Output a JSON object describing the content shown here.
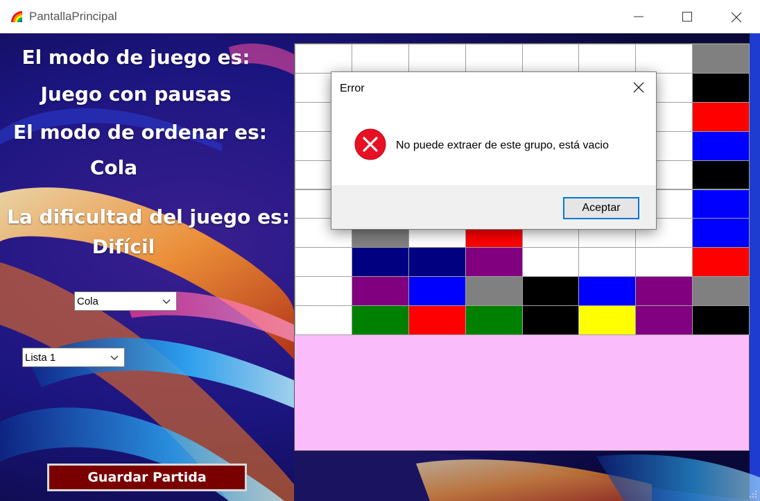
{
  "window": {
    "title": "PantallaPrincipal"
  },
  "labels": {
    "game_mode_heading": "El modo de juego es:",
    "game_mode_value": "Juego con pausas",
    "sort_mode_heading": "El modo de ordenar es:",
    "sort_mode_value": "Cola",
    "difficulty_heading": "La dificultad del juego es:",
    "difficulty_value": "Difícil"
  },
  "combos": {
    "sort_combo_value": "Cola",
    "list_combo_value": "Lista 1"
  },
  "save_button_label": "Guardar Partida",
  "board": {
    "rows": 10,
    "cols": 8,
    "cells": [
      [
        "#ffffff",
        "#ffffff",
        "#ffffff",
        "#ffffff",
        "#ffffff",
        "#ffffff",
        "#ffffff",
        "#808080"
      ],
      [
        "#ffffff",
        "#ffffff",
        "#ffffff",
        "#ffffff",
        "#ffffff",
        "#ffffff",
        "#ffffff",
        "#000000"
      ],
      [
        "#ffffff",
        "#ffffff",
        "#ffffff",
        "#ffffff",
        "#ffffff",
        "#ffffff",
        "#ffffff",
        "#ff0000"
      ],
      [
        "#ffffff",
        "#ffffff",
        "#ffffff",
        "#ffffff",
        "#ffffff",
        "#ffffff",
        "#ffffff",
        "#0000ff"
      ],
      [
        "#ffffff",
        "#ffffff",
        "#ffffff",
        "#ffffff",
        "#ffffff",
        "#ffffff",
        "#ffffff",
        "#000000"
      ],
      [
        "#ffffff",
        "#ffffff",
        "#ffffff",
        "#ffffff",
        "#ffffff",
        "#ffffff",
        "#ffffff",
        "#0000ff"
      ],
      [
        "#ffffff",
        "#808080",
        "#ffffff",
        "#ff0000",
        "#ffffff",
        "#ffffff",
        "#ffffff",
        "#0000ff"
      ],
      [
        "#ffffff",
        "#000080",
        "#000080",
        "#800080",
        "#ffffff",
        "#ffffff",
        "#ffffff",
        "#ff0000"
      ],
      [
        "#ffffff",
        "#800080",
        "#0000ff",
        "#808080",
        "#000000",
        "#0000ff",
        "#800080",
        "#808080"
      ],
      [
        "#ffffff",
        "#008000",
        "#ff0000",
        "#008000",
        "#000000",
        "#ffff00",
        "#800080",
        "#000000"
      ]
    ]
  },
  "dialog": {
    "title": "Error",
    "message": "No puede extraer de este grupo, está vacio",
    "ok_label": "Aceptar"
  },
  "colors": {
    "save_button_bg": "#7a0000",
    "pink_panel": "#fbbcfb",
    "accent": "#0078d7",
    "error_red": "#e81123"
  }
}
